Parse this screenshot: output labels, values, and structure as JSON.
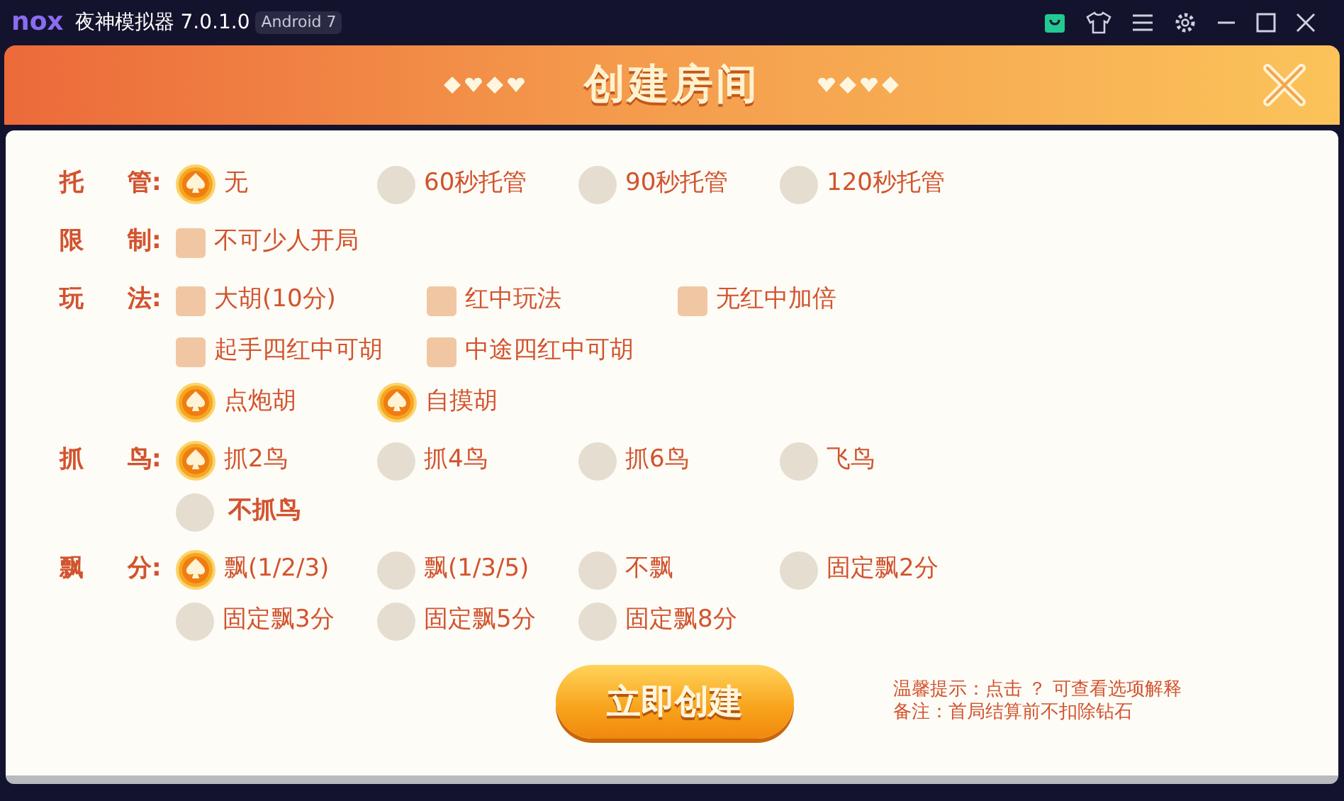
{
  "window": {
    "logo": "nox",
    "title": "夜神模拟器 7.0.1.0",
    "badge": "Android 7"
  },
  "dialog": {
    "title": "创建房间"
  },
  "sections": [
    {
      "label": [
        "托",
        "管:"
      ],
      "rows": [
        {
          "kind": "radio",
          "options": [
            {
              "label": "无",
              "selected": true
            },
            {
              "label": "60秒托管",
              "selected": false
            },
            {
              "label": "90秒托管",
              "selected": false
            },
            {
              "label": "120秒托管",
              "selected": false
            }
          ]
        }
      ]
    },
    {
      "label": [
        "限",
        "制:"
      ],
      "rows": [
        {
          "kind": "checkbox",
          "options": [
            {
              "label": "不可少人开局",
              "checked": false
            }
          ]
        }
      ]
    },
    {
      "label": [
        "玩",
        "法:"
      ],
      "rows": [
        {
          "kind": "checkbox",
          "options": [
            {
              "label": "大胡(10分)",
              "checked": false
            },
            {
              "label": "红中玩法",
              "checked": false
            },
            {
              "label": "无红中加倍",
              "checked": false
            }
          ]
        },
        {
          "kind": "checkbox",
          "options": [
            {
              "label": "起手四红中可胡",
              "checked": false
            },
            {
              "label": "中途四红中可胡",
              "checked": false
            }
          ]
        },
        {
          "kind": "radio",
          "options": [
            {
              "label": "点炮胡",
              "selected": true
            },
            {
              "label": "自摸胡",
              "selected": true
            }
          ]
        }
      ]
    },
    {
      "label": [
        "抓",
        "鸟:"
      ],
      "rows": [
        {
          "kind": "radio",
          "options": [
            {
              "label": "抓2鸟",
              "selected": true
            },
            {
              "label": "抓4鸟",
              "selected": false
            },
            {
              "label": "抓6鸟",
              "selected": false
            },
            {
              "label": "飞鸟",
              "selected": false
            }
          ]
        },
        {
          "kind": "radio",
          "options": [
            {
              "label": "不抓鸟",
              "selected": false,
              "bold": true
            }
          ]
        }
      ]
    },
    {
      "label": [
        "飘",
        "分:"
      ],
      "rows": [
        {
          "kind": "radio",
          "options": [
            {
              "label": "飘(1/2/3)",
              "selected": true
            },
            {
              "label": "飘(1/3/5)",
              "selected": false
            },
            {
              "label": "不飘",
              "selected": false
            },
            {
              "label": "固定飘2分",
              "selected": false
            }
          ]
        },
        {
          "kind": "radio",
          "options": [
            {
              "label": "固定飘3分",
              "selected": false
            },
            {
              "label": "固定飘5分",
              "selected": false
            },
            {
              "label": "固定飘8分",
              "selected": false
            }
          ]
        }
      ]
    }
  ],
  "create_button": "立即创建",
  "notes": [
    "温馨提示：点击 ？  可查看选项解释",
    "备注：首局结算前不扣除钻石"
  ]
}
